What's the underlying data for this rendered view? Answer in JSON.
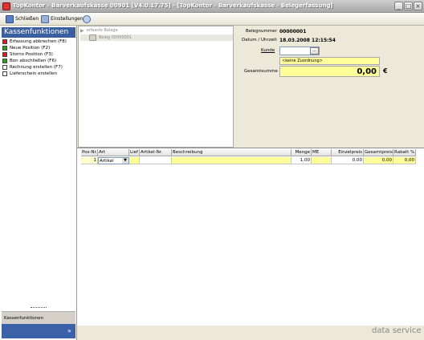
{
  "window": {
    "title": "TopKontor - Barverkaufskasse 00901 [V4.0.17.75] - [TopKontor - Barverkaufskasse - Belegerfassung]",
    "controls": [
      "_",
      "□",
      "×"
    ]
  },
  "toolbar": {
    "close_label": "Schließen",
    "settings_label": "Einstellungen"
  },
  "sidebar": {
    "header": "Kassenfunktionen",
    "items": [
      {
        "label": "Erfassung abbrechen (F8)",
        "icon": "stop-icon",
        "color": "#d62020"
      },
      {
        "label": "Neue Position (F2)",
        "icon": "add-icon",
        "color": "#2aa02a"
      },
      {
        "label": "Storno Position (F3)",
        "icon": "cancel-icon",
        "color": "#d62020"
      },
      {
        "label": "Bon abschließen (F6)",
        "icon": "confirm-icon",
        "color": "#2aa02a"
      },
      {
        "label": "Rechnung erstellen (F7)",
        "icon": "invoice-icon",
        "color": "#ffffff"
      },
      {
        "label": "Lieferschein erstellen",
        "icon": "delivery-note-icon",
        "color": "#ffffff"
      }
    ],
    "footer_label": "Kassenfunktionen"
  },
  "tree": {
    "root": "erfasste Belege",
    "child": "Beleg 00000001"
  },
  "info": {
    "belegnummer_label": "Belegnummer",
    "belegnummer_value": "00000001",
    "datum_label": "Datum / Uhrzeit",
    "datum_value": "18.03.2008  12:15:54",
    "kunde_label": "Kunde",
    "kunde_value": "",
    "kunde_button": "...",
    "zuordnung_value": "<keine Zuordnung>",
    "gesamtsumme_label": "Gesamtsumme",
    "gesamtsumme_value": "0,00",
    "currency": "€"
  },
  "grid": {
    "headers": [
      "Pos-Nr.",
      "Art",
      "Lief",
      "Artikel-Nr.",
      "Beschreibung",
      "Menge",
      "ME",
      "Einzelpreis",
      "Gesamtpreis",
      "Rabatt %"
    ],
    "row": [
      "1",
      "Artikel",
      "",
      "",
      "",
      "1,00",
      "",
      "0,00",
      "0,00",
      "0,00"
    ]
  },
  "footer": {
    "brand": "data service"
  },
  "colors": {
    "accent": "#3b62a8",
    "highlight": "#ffff99"
  }
}
